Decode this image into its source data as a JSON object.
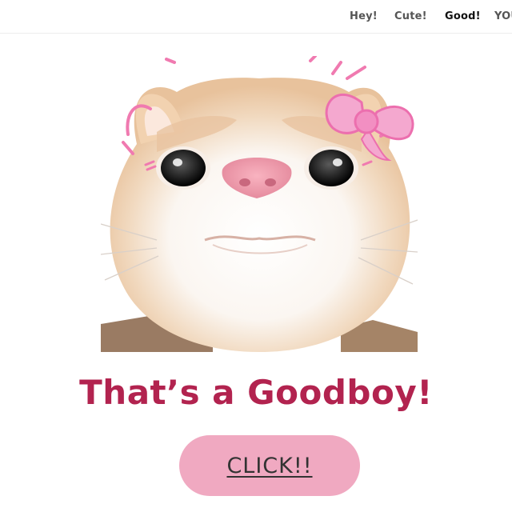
{
  "nav": {
    "items": [
      {
        "label": "Hey!"
      },
      {
        "label": "Cute!"
      },
      {
        "label": "Good!"
      },
      {
        "label": "YOU"
      }
    ]
  },
  "hero": {
    "image": "cat-face-photo",
    "decorations": [
      "pink-bow-icon",
      "pink-sparkle-lines"
    ]
  },
  "headline": "That’s a Goodboy!",
  "cta": {
    "label": "CLICK!!"
  },
  "colors": {
    "headline": "#b2234f",
    "button": "#f0a9c1",
    "accent_pink": "#f07ab0",
    "nav_text": "#555555"
  }
}
